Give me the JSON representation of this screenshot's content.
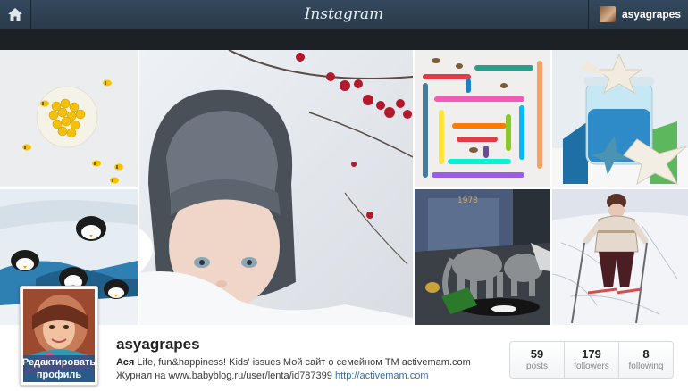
{
  "header": {
    "logo": "Instagram",
    "username": "asyagrapes",
    "home_icon": "home-icon"
  },
  "photos": [
    {
      "id": "bees-on-plate"
    },
    {
      "id": "child-in-snow"
    },
    {
      "id": "colorful-pencil-maze"
    },
    {
      "id": "jar-starfish"
    },
    {
      "id": "paper-penguins"
    },
    {
      "id": "toy-animals"
    },
    {
      "id": "child-skiing"
    }
  ],
  "profile": {
    "username": "asyagrapes",
    "edit_button": "Редактировать профиль",
    "bio_name": "Ася",
    "bio_line1": "Life, fun&happiness! Kids' issues Мой сайт о семейном ТМ activemam.com",
    "bio_line2_text": "Журнал на www.babyblog.ru/user/lenta/id787399",
    "bio_link": "http://activemam.com"
  },
  "stats": [
    {
      "count": "59",
      "label": "posts"
    },
    {
      "count": "179",
      "label": "followers"
    },
    {
      "count": "8",
      "label": "following"
    }
  ]
}
